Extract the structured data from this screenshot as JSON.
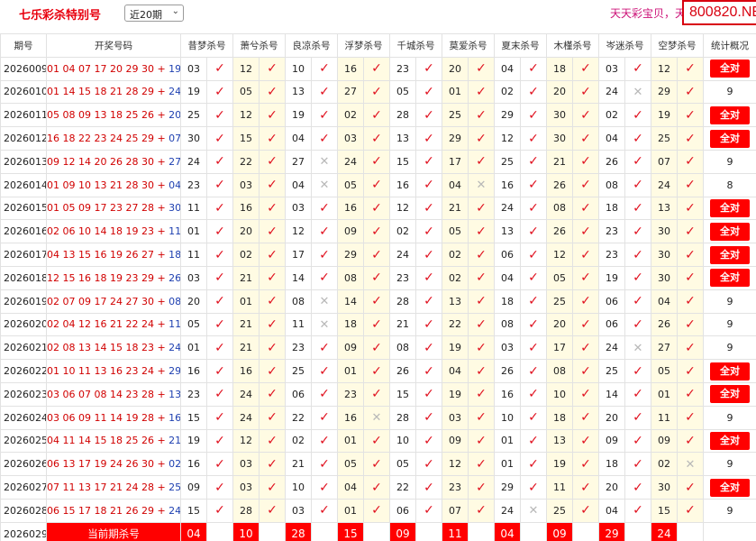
{
  "header": {
    "title": "七乐彩杀特别号",
    "period_select": "近20期",
    "promo_text": "天天彩宝贝，天",
    "site_badge": "800820.NET"
  },
  "table": {
    "columns": [
      "期号",
      "开奖号码",
      "昔梦杀号",
      "萧兮杀号",
      "良凉杀号",
      "浮梦杀号",
      "千城杀号",
      "莫爱杀号",
      "夏末杀号",
      "木槿杀号",
      "岑迷杀号",
      "空梦杀号",
      "统计概况"
    ],
    "rows": [
      {
        "issue": "2026009",
        "numbers": "01 04 07 17 20 29 30 +",
        "special": "19",
        "kills": [
          [
            "03",
            "ok"
          ],
          [
            "12",
            "ok"
          ],
          [
            "10",
            "ok"
          ],
          [
            "16",
            "ok"
          ],
          [
            "23",
            "ok"
          ],
          [
            "20",
            "ok"
          ],
          [
            "04",
            "ok"
          ],
          [
            "18",
            "ok"
          ],
          [
            "03",
            "ok"
          ],
          [
            "12",
            "ok"
          ]
        ],
        "stat": "全对",
        "all": true
      },
      {
        "issue": "2026010",
        "numbers": "01 14 15 18 21 28 29 +",
        "special": "24",
        "kills": [
          [
            "19",
            "ok"
          ],
          [
            "05",
            "ok"
          ],
          [
            "13",
            "ok"
          ],
          [
            "27",
            "ok"
          ],
          [
            "05",
            "ok"
          ],
          [
            "01",
            "ok"
          ],
          [
            "02",
            "ok"
          ],
          [
            "20",
            "ok"
          ],
          [
            "24",
            "bad"
          ],
          [
            "29",
            "ok"
          ]
        ],
        "stat": "9",
        "all": false
      },
      {
        "issue": "2026011",
        "numbers": "05 08 09 13 18 25 26 +",
        "special": "20",
        "kills": [
          [
            "25",
            "ok"
          ],
          [
            "12",
            "ok"
          ],
          [
            "19",
            "ok"
          ],
          [
            "02",
            "ok"
          ],
          [
            "28",
            "ok"
          ],
          [
            "25",
            "ok"
          ],
          [
            "29",
            "ok"
          ],
          [
            "30",
            "ok"
          ],
          [
            "02",
            "ok"
          ],
          [
            "19",
            "ok"
          ]
        ],
        "stat": "全对",
        "all": true
      },
      {
        "issue": "2026012",
        "numbers": "16 18 22 23 24 25 29 +",
        "special": "07",
        "kills": [
          [
            "30",
            "ok"
          ],
          [
            "15",
            "ok"
          ],
          [
            "04",
            "ok"
          ],
          [
            "03",
            "ok"
          ],
          [
            "13",
            "ok"
          ],
          [
            "29",
            "ok"
          ],
          [
            "12",
            "ok"
          ],
          [
            "30",
            "ok"
          ],
          [
            "04",
            "ok"
          ],
          [
            "25",
            "ok"
          ]
        ],
        "stat": "全对",
        "all": true
      },
      {
        "issue": "2026013",
        "numbers": "09 12 14 20 26 28 30 +",
        "special": "27",
        "kills": [
          [
            "24",
            "ok"
          ],
          [
            "22",
            "ok"
          ],
          [
            "27",
            "bad"
          ],
          [
            "24",
            "ok"
          ],
          [
            "15",
            "ok"
          ],
          [
            "17",
            "ok"
          ],
          [
            "25",
            "ok"
          ],
          [
            "21",
            "ok"
          ],
          [
            "26",
            "ok"
          ],
          [
            "07",
            "ok"
          ]
        ],
        "stat": "9",
        "all": false
      },
      {
        "issue": "2026014",
        "numbers": "01 09 10 13 21 28 30 +",
        "special": "04",
        "kills": [
          [
            "23",
            "ok"
          ],
          [
            "03",
            "ok"
          ],
          [
            "04",
            "bad"
          ],
          [
            "05",
            "ok"
          ],
          [
            "16",
            "ok"
          ],
          [
            "04",
            "bad"
          ],
          [
            "16",
            "ok"
          ],
          [
            "26",
            "ok"
          ],
          [
            "08",
            "ok"
          ],
          [
            "24",
            "ok"
          ]
        ],
        "stat": "8",
        "all": false
      },
      {
        "issue": "2026015",
        "numbers": "01 05 09 17 23 27 28 +",
        "special": "30",
        "kills": [
          [
            "11",
            "ok"
          ],
          [
            "16",
            "ok"
          ],
          [
            "03",
            "ok"
          ],
          [
            "16",
            "ok"
          ],
          [
            "12",
            "ok"
          ],
          [
            "21",
            "ok"
          ],
          [
            "24",
            "ok"
          ],
          [
            "08",
            "ok"
          ],
          [
            "18",
            "ok"
          ],
          [
            "13",
            "ok"
          ]
        ],
        "stat": "全对",
        "all": true
      },
      {
        "issue": "2026016",
        "numbers": "02 06 10 14 18 19 23 +",
        "special": "11",
        "kills": [
          [
            "01",
            "ok"
          ],
          [
            "20",
            "ok"
          ],
          [
            "12",
            "ok"
          ],
          [
            "09",
            "ok"
          ],
          [
            "02",
            "ok"
          ],
          [
            "05",
            "ok"
          ],
          [
            "13",
            "ok"
          ],
          [
            "26",
            "ok"
          ],
          [
            "23",
            "ok"
          ],
          [
            "30",
            "ok"
          ]
        ],
        "stat": "全对",
        "all": true
      },
      {
        "issue": "2026017",
        "numbers": "04 13 15 16 19 26 27 +",
        "special": "18",
        "kills": [
          [
            "11",
            "ok"
          ],
          [
            "02",
            "ok"
          ],
          [
            "17",
            "ok"
          ],
          [
            "29",
            "ok"
          ],
          [
            "24",
            "ok"
          ],
          [
            "02",
            "ok"
          ],
          [
            "06",
            "ok"
          ],
          [
            "12",
            "ok"
          ],
          [
            "23",
            "ok"
          ],
          [
            "30",
            "ok"
          ]
        ],
        "stat": "全对",
        "all": true
      },
      {
        "issue": "2026018",
        "numbers": "12 15 16 18 19 23 29 +",
        "special": "26",
        "kills": [
          [
            "03",
            "ok"
          ],
          [
            "21",
            "ok"
          ],
          [
            "14",
            "ok"
          ],
          [
            "08",
            "ok"
          ],
          [
            "23",
            "ok"
          ],
          [
            "02",
            "ok"
          ],
          [
            "04",
            "ok"
          ],
          [
            "05",
            "ok"
          ],
          [
            "19",
            "ok"
          ],
          [
            "30",
            "ok"
          ]
        ],
        "stat": "全对",
        "all": true
      },
      {
        "issue": "2026019",
        "numbers": "02 07 09 17 24 27 30 +",
        "special": "08",
        "kills": [
          [
            "20",
            "ok"
          ],
          [
            "01",
            "ok"
          ],
          [
            "08",
            "bad"
          ],
          [
            "14",
            "ok"
          ],
          [
            "28",
            "ok"
          ],
          [
            "13",
            "ok"
          ],
          [
            "18",
            "ok"
          ],
          [
            "25",
            "ok"
          ],
          [
            "06",
            "ok"
          ],
          [
            "04",
            "ok"
          ]
        ],
        "stat": "9",
        "all": false
      },
      {
        "issue": "2026020",
        "numbers": "02 04 12 16 21 22 24 +",
        "special": "11",
        "kills": [
          [
            "05",
            "ok"
          ],
          [
            "21",
            "ok"
          ],
          [
            "11",
            "bad"
          ],
          [
            "18",
            "ok"
          ],
          [
            "21",
            "ok"
          ],
          [
            "22",
            "ok"
          ],
          [
            "08",
            "ok"
          ],
          [
            "20",
            "ok"
          ],
          [
            "06",
            "ok"
          ],
          [
            "26",
            "ok"
          ]
        ],
        "stat": "9",
        "all": false
      },
      {
        "issue": "2026021",
        "numbers": "02 08 13 14 15 18 23 +",
        "special": "24",
        "kills": [
          [
            "01",
            "ok"
          ],
          [
            "21",
            "ok"
          ],
          [
            "23",
            "ok"
          ],
          [
            "09",
            "ok"
          ],
          [
            "08",
            "ok"
          ],
          [
            "19",
            "ok"
          ],
          [
            "03",
            "ok"
          ],
          [
            "17",
            "ok"
          ],
          [
            "24",
            "bad"
          ],
          [
            "27",
            "ok"
          ]
        ],
        "stat": "9",
        "all": false
      },
      {
        "issue": "2026022",
        "numbers": "01 10 11 13 16 23 24 +",
        "special": "29",
        "kills": [
          [
            "16",
            "ok"
          ],
          [
            "16",
            "ok"
          ],
          [
            "25",
            "ok"
          ],
          [
            "01",
            "ok"
          ],
          [
            "26",
            "ok"
          ],
          [
            "04",
            "ok"
          ],
          [
            "26",
            "ok"
          ],
          [
            "08",
            "ok"
          ],
          [
            "25",
            "ok"
          ],
          [
            "05",
            "ok"
          ]
        ],
        "stat": "全对",
        "all": true
      },
      {
        "issue": "2026023",
        "numbers": "03 06 07 08 14 23 28 +",
        "special": "13",
        "kills": [
          [
            "23",
            "ok"
          ],
          [
            "24",
            "ok"
          ],
          [
            "06",
            "ok"
          ],
          [
            "23",
            "ok"
          ],
          [
            "15",
            "ok"
          ],
          [
            "19",
            "ok"
          ],
          [
            "16",
            "ok"
          ],
          [
            "10",
            "ok"
          ],
          [
            "14",
            "ok"
          ],
          [
            "01",
            "ok"
          ]
        ],
        "stat": "全对",
        "all": true
      },
      {
        "issue": "2026024",
        "numbers": "03 06 09 11 14 19 28 +",
        "special": "16",
        "kills": [
          [
            "15",
            "ok"
          ],
          [
            "24",
            "ok"
          ],
          [
            "22",
            "ok"
          ],
          [
            "16",
            "bad"
          ],
          [
            "28",
            "ok"
          ],
          [
            "03",
            "ok"
          ],
          [
            "10",
            "ok"
          ],
          [
            "18",
            "ok"
          ],
          [
            "20",
            "ok"
          ],
          [
            "11",
            "ok"
          ]
        ],
        "stat": "9",
        "all": false
      },
      {
        "issue": "2026025",
        "numbers": "04 11 14 15 18 25 26 +",
        "special": "21",
        "kills": [
          [
            "19",
            "ok"
          ],
          [
            "12",
            "ok"
          ],
          [
            "02",
            "ok"
          ],
          [
            "01",
            "ok"
          ],
          [
            "10",
            "ok"
          ],
          [
            "09",
            "ok"
          ],
          [
            "01",
            "ok"
          ],
          [
            "13",
            "ok"
          ],
          [
            "09",
            "ok"
          ],
          [
            "09",
            "ok"
          ]
        ],
        "stat": "全对",
        "all": true
      },
      {
        "issue": "2026026",
        "numbers": "06 13 17 19 24 26 30 +",
        "special": "02",
        "kills": [
          [
            "16",
            "ok"
          ],
          [
            "03",
            "ok"
          ],
          [
            "21",
            "ok"
          ],
          [
            "05",
            "ok"
          ],
          [
            "05",
            "ok"
          ],
          [
            "12",
            "ok"
          ],
          [
            "01",
            "ok"
          ],
          [
            "19",
            "ok"
          ],
          [
            "18",
            "ok"
          ],
          [
            "02",
            "bad"
          ]
        ],
        "stat": "9",
        "all": false
      },
      {
        "issue": "2026027",
        "numbers": "07 11 13 17 21 24 28 +",
        "special": "25",
        "kills": [
          [
            "09",
            "ok"
          ],
          [
            "03",
            "ok"
          ],
          [
            "10",
            "ok"
          ],
          [
            "04",
            "ok"
          ],
          [
            "22",
            "ok"
          ],
          [
            "23",
            "ok"
          ],
          [
            "29",
            "ok"
          ],
          [
            "11",
            "ok"
          ],
          [
            "20",
            "ok"
          ],
          [
            "30",
            "ok"
          ]
        ],
        "stat": "全对",
        "all": true
      },
      {
        "issue": "2026028",
        "numbers": "06 15 17 18 21 26 29 +",
        "special": "24",
        "kills": [
          [
            "15",
            "ok"
          ],
          [
            "28",
            "ok"
          ],
          [
            "03",
            "ok"
          ],
          [
            "01",
            "ok"
          ],
          [
            "06",
            "ok"
          ],
          [
            "07",
            "ok"
          ],
          [
            "24",
            "bad"
          ],
          [
            "25",
            "ok"
          ],
          [
            "04",
            "ok"
          ],
          [
            "15",
            "ok"
          ]
        ],
        "stat": "9",
        "all": false
      }
    ],
    "current": {
      "issue": "2026029",
      "label": "当前期杀号",
      "kills": [
        "04",
        "10",
        "28",
        "15",
        "09",
        "11",
        "04",
        "09",
        "29",
        "24"
      ]
    }
  },
  "marks": {
    "ok": "✓",
    "bad": "✕"
  },
  "colors": {
    "red": "#ff0000",
    "title": "#e8000e",
    "special_blue": "#1d3fb0",
    "alt_col": "#fffbe3"
  }
}
